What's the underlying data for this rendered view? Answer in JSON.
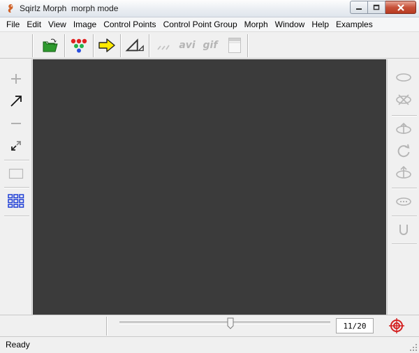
{
  "window": {
    "title": "Sqirlz Morph",
    "mode": "morph mode"
  },
  "menu": [
    {
      "label": "File"
    },
    {
      "label": "Edit"
    },
    {
      "label": "View"
    },
    {
      "label": "Image"
    },
    {
      "label": "Control Points"
    },
    {
      "label": "Control Point Group"
    },
    {
      "label": "Morph"
    },
    {
      "label": "Window"
    },
    {
      "label": "Help"
    },
    {
      "label": "Examples"
    }
  ],
  "toolbar": {
    "avi_label": "avi",
    "gif_label": "gif"
  },
  "timeline": {
    "frame": "11/20",
    "current_frame": 11,
    "total_frames": 20
  },
  "status": {
    "text": "Ready"
  },
  "colors": {
    "canvas": "#3b3b3b",
    "folder_green": "#2e9a2e",
    "arrow_yellow": "#ffea00",
    "grid_blue": "#1f3fd6",
    "target_red": "#d42020",
    "disabled_gray": "#b5b5b5"
  },
  "icons": {
    "app": "squirrel-icon",
    "open": "open-folder-icon",
    "control_points": "dots-tree-icon",
    "morph": "yellow-arrow-icon",
    "angle": "angle-ruler-icon",
    "line": "dashed-line-icon",
    "frame": "frame-panel-icon"
  }
}
